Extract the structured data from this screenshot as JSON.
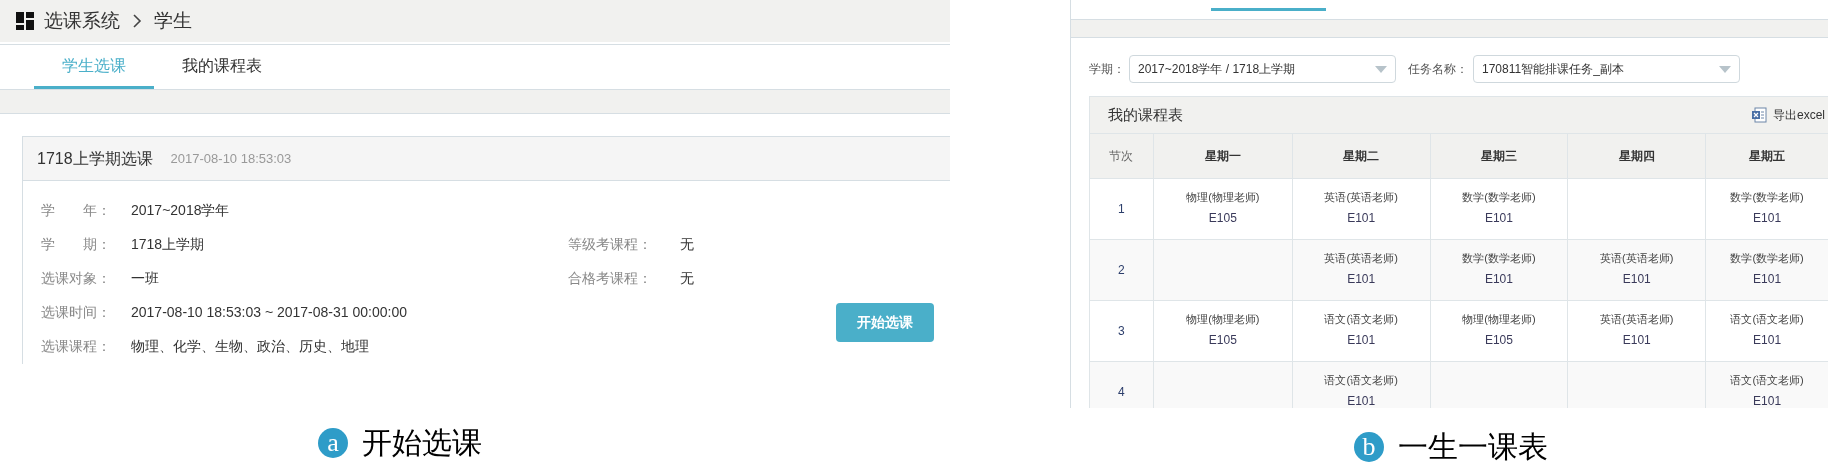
{
  "figures": [
    {
      "badge": "a",
      "caption": "开始选课",
      "breadcrumb": {
        "root": "选课系统",
        "current": "学生"
      },
      "tabs": [
        {
          "label": "学生选课",
          "selected": true
        },
        {
          "label": "我的课程表",
          "selected": false
        }
      ],
      "card": {
        "title": "1718上学期选课",
        "timestamp": "2017-08-10 18:53:03",
        "fields": [
          {
            "label": "学　　年：",
            "value": "2017~2018学年"
          },
          {
            "label": "学　　期：",
            "value": "1718上学期"
          },
          {
            "label": "选课对象：",
            "value": "一班"
          },
          {
            "label": "选课时间：",
            "value": "2017-08-10 18:53:03 ~ 2017-08-31 00:00:00"
          },
          {
            "label": "选课课程：",
            "value": "物理、化学、生物、政治、历史、地理"
          }
        ],
        "side_fields": [
          {
            "label": "等级考课程：",
            "value": "无"
          },
          {
            "label": "合格考课程：",
            "value": "无"
          }
        ],
        "button": "开始选课"
      }
    },
    {
      "badge": "b",
      "caption": "一生一课表",
      "filters": [
        {
          "label": "学期：",
          "value": "2017~2018学年 / 1718上学期"
        },
        {
          "label": "任务名称：",
          "value": "170811智能排课任务_副本"
        }
      ],
      "timetable": {
        "title": "我的课程表",
        "export": "导出excel",
        "columns": [
          "节次",
          "星期一",
          "星期二",
          "星期三",
          "星期四",
          "星期五"
        ],
        "rows": [
          {
            "cells": [
              "1",
              {
                "course": "物理(物理老师)",
                "room": "E105"
              },
              {
                "course": "英语(英语老师)",
                "room": "E101"
              },
              {
                "course": "数学(数学老师)",
                "room": "E101"
              },
              "",
              {
                "course": "数学(数学老师)",
                "room": "E101"
              }
            ]
          },
          {
            "cells": [
              "2",
              "",
              {
                "course": "英语(英语老师)",
                "room": "E101"
              },
              {
                "course": "数学(数学老师)",
                "room": "E101"
              },
              {
                "course": "英语(英语老师)",
                "room": "E101"
              },
              {
                "course": "数学(数学老师)",
                "room": "E101"
              }
            ]
          },
          {
            "cells": [
              "3",
              {
                "course": "物理(物理老师)",
                "room": "E105"
              },
              {
                "course": "语文(语文老师)",
                "room": "E101"
              },
              {
                "course": "物理(物理老师)",
                "room": "E105"
              },
              {
                "course": "英语(英语老师)",
                "room": "E101"
              },
              {
                "course": "语文(语文老师)",
                "room": "E101"
              }
            ]
          },
          {
            "cells": [
              "4",
              "",
              {
                "course": "语文(语文老师)",
                "room": "E101"
              },
              "",
              "",
              {
                "course": "语文(语文老师)",
                "room": "E101"
              }
            ]
          }
        ]
      }
    }
  ]
}
